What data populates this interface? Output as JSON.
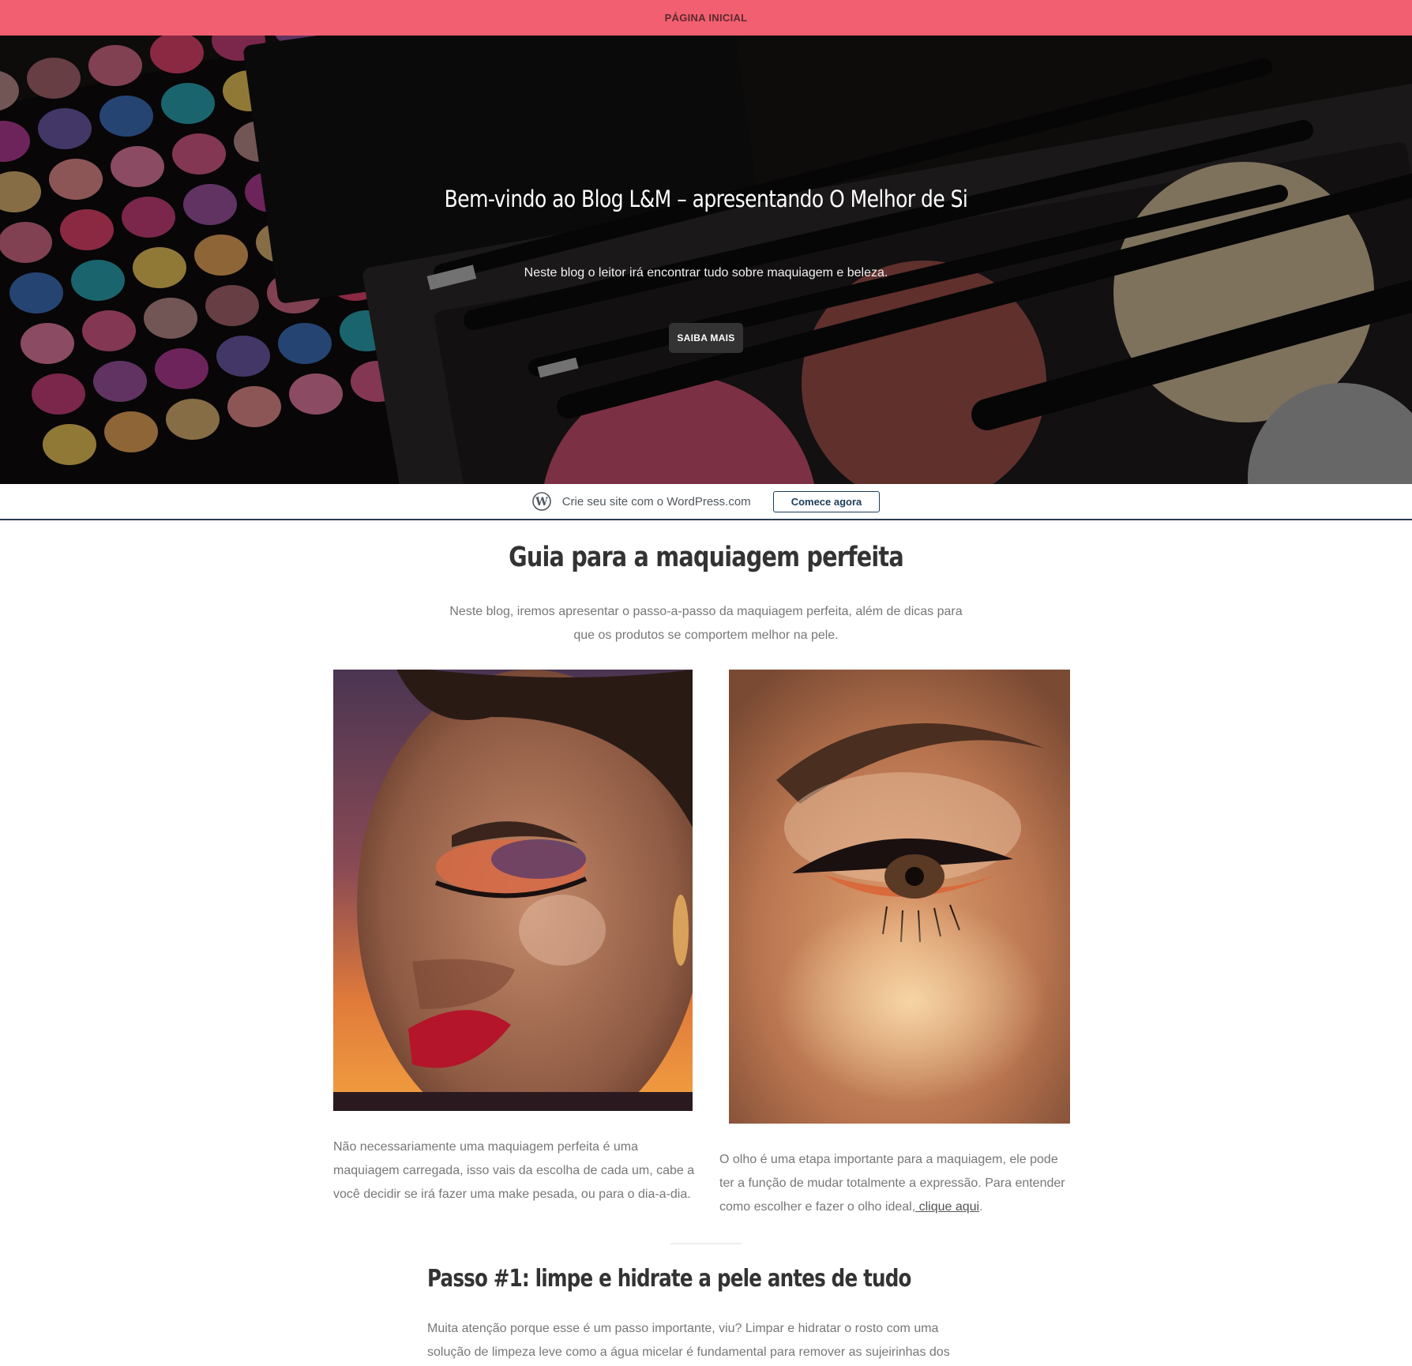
{
  "nav": {
    "home_label": "PÁGINA INICIAL"
  },
  "hero": {
    "title": "Bem-vindo ao Blog L&M – apresentando O Melhor de Si",
    "subtitle": "Neste blog o leitor irá encontrar tudo sobre maquiagem e beleza.",
    "button_label": "SAIBA MAIS"
  },
  "wordpress_bar": {
    "text": "Crie seu site com o WordPress.com",
    "button_label": "Comece agora"
  },
  "section": {
    "title": "Guia para a maquiagem perfeita",
    "intro": "Neste blog, iremos apresentar o passo-a-passo da maquiagem perfeita, além de dicas para que os produtos se comportem melhor na pele."
  },
  "gallery": [
    {
      "caption": "Não necessariamente uma maquiagem perfeita é uma maquiagem carregada, isso vais da escolha de cada um, cabe a você decidir se irá fazer uma make pesada, ou para o dia-a-dia."
    },
    {
      "caption_before_link": "O olho é uma etapa importante para a maquiagem, ele pode ter a função de mudar totalmente a expressão. Para entender como escolher e fazer o olho ideal,",
      "link_label": " clique aqui",
      "caption_after_link": "."
    }
  ],
  "step1": {
    "title": "Passo #1: limpe e hidrate a pele antes de tudo",
    "text": "Muita atenção porque esse é um passo importante, viu? Limpar e hidratar o rosto com uma solução de limpeza leve como a água micelar é fundamental para remover as sujeirinhas dos poros, suavizar o"
  },
  "colors": {
    "topbar": "#f25f70",
    "button_dark": "#333333",
    "wp_accent": "#1c3d5a"
  }
}
